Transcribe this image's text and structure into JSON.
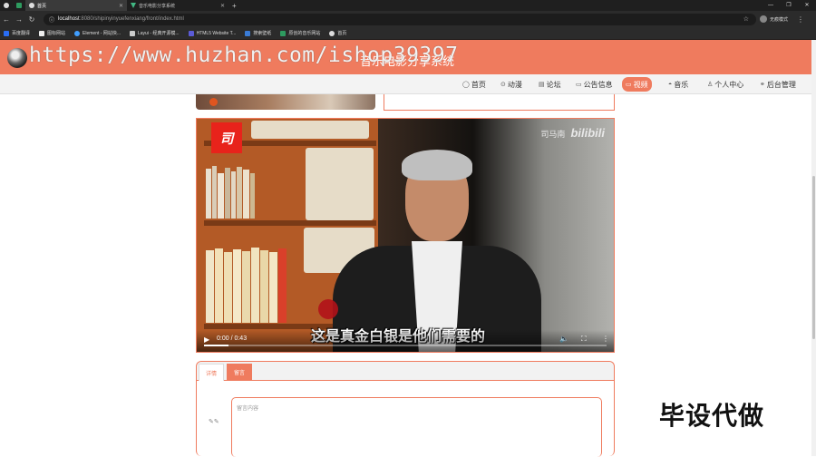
{
  "browser": {
    "tabs": [
      {
        "label": "首页",
        "active": true
      },
      {
        "label": "音乐电影分享系统",
        "active": false
      }
    ],
    "url_host": "localhost",
    "url_path": ":8080/shipinyinyuefenxiang/front/index.html",
    "profile_label": "无痕模式",
    "bookmarks": [
      "百度翻译",
      "图标网站",
      "Element - 网站快...",
      "Layui - 经典开源模...",
      "HTML5 Website T...",
      "搜索壁纸",
      "原创的音乐网站",
      "首页"
    ]
  },
  "header": {
    "site_title": "音乐电影分享系统",
    "watermark": "https://www.huzhan.com/ishop39397"
  },
  "nav": {
    "items": [
      "首页",
      "动漫",
      "论坛",
      "公告信息",
      "视频",
      "音乐",
      "个人中心",
      "后台管理"
    ],
    "active": "视频"
  },
  "video": {
    "brand_small": "司马南",
    "brand_big": "bilibili",
    "logo_char": "司",
    "subtitle": "这是真金白银是他们需要的",
    "time": "0:00 / 0:43",
    "progress": 0.06
  },
  "comments": {
    "tab_detail": "详情",
    "tab_comment": "留言",
    "active_tab": "留言",
    "placeholder": "留言内容"
  },
  "promo": "毕设代做",
  "colors": {
    "accent": "#ef7b5e",
    "dark_chrome": "#2b2b2b"
  }
}
